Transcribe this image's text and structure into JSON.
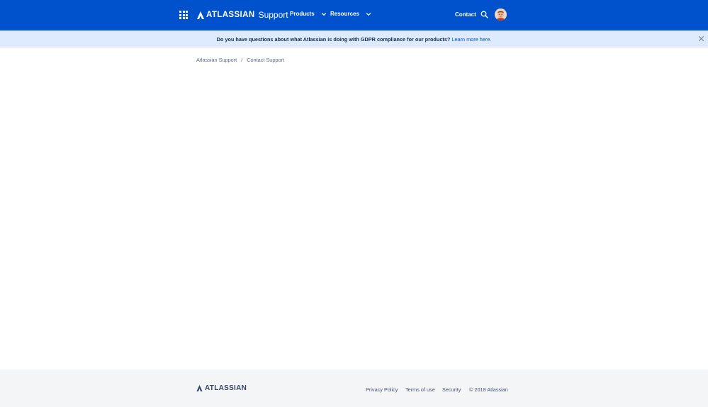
{
  "header": {
    "logo_word": "ATLASSIAN",
    "logo_sub": "Support",
    "nav": [
      {
        "label": "Products"
      },
      {
        "label": "Resources"
      }
    ],
    "contact_label": "Contact",
    "icons": {
      "app_switcher": "app-switcher-icon",
      "search": "search-icon",
      "avatar": "avatar",
      "chevron": "chevron-down-icon"
    },
    "color": "#0052cc"
  },
  "banner": {
    "text": "Do you have questions about what Atlassian is doing with GDPR compliance for our products?",
    "link": "Learn more here.",
    "background": "#deebff",
    "close_icon": "close-icon"
  },
  "breadcrumb": {
    "items": [
      "Atlassian Support",
      "Contact Support"
    ],
    "separator": "/"
  },
  "footer": {
    "logo_word": "ATLASSIAN",
    "links": [
      "Privacy Policy",
      "Terms of use",
      "Security"
    ],
    "copyright": "© 2018 Atlassian",
    "background": "#f4f5f7"
  }
}
